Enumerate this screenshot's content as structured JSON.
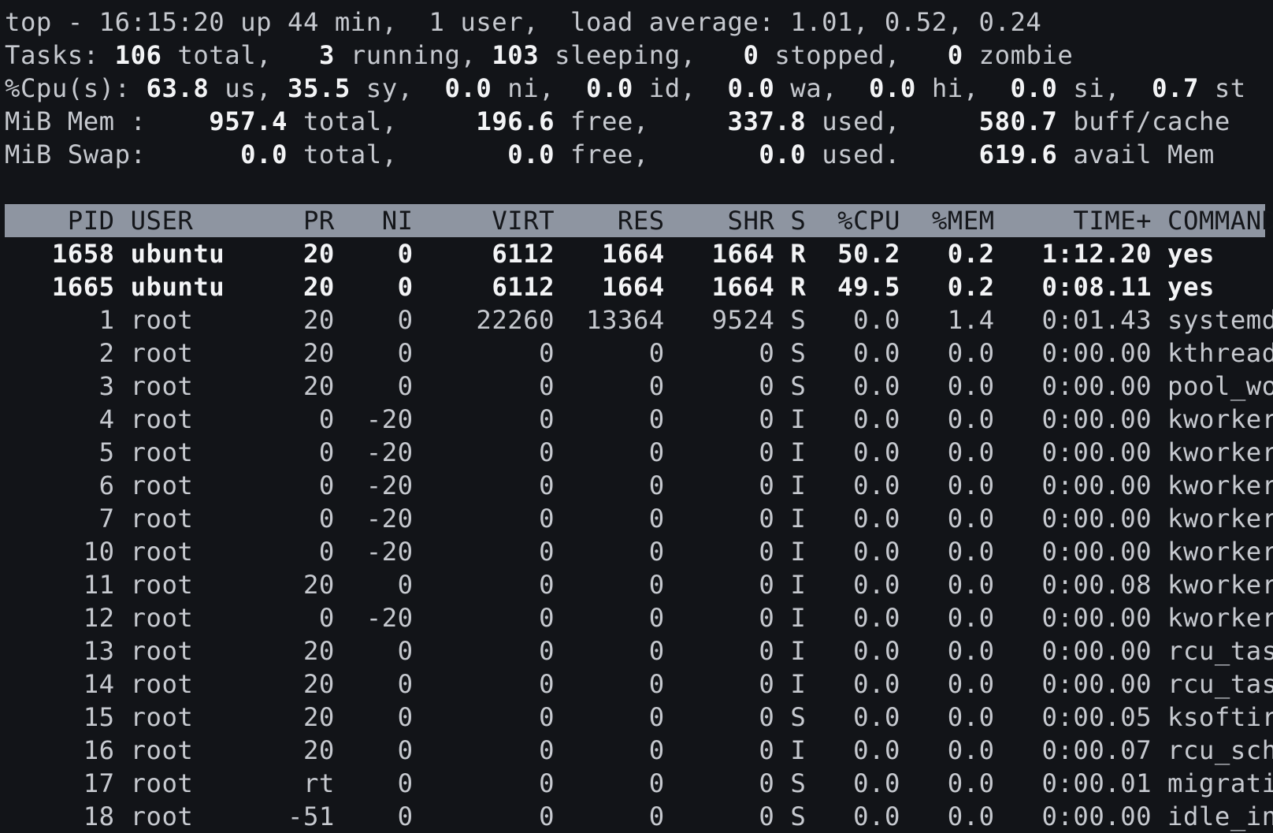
{
  "summary": {
    "top_line": "top - 16:15:20 up 44 min,  1 user,  load average: 1.01, 0.52, 0.24",
    "tasks": {
      "label": "Tasks:",
      "total": "106",
      "total_label": " total,",
      "running": "3",
      "running_label": " running,",
      "sleeping": "103",
      "sleeping_label": " sleeping,",
      "stopped": "0",
      "stopped_label": " stopped,",
      "zombie": "0",
      "zombie_label": " zombie"
    },
    "cpu": {
      "label": "%Cpu(s):",
      "us": "63.8",
      "us_label": " us,",
      "sy": "35.5",
      "sy_label": " sy,",
      "ni": "0.0",
      "ni_label": " ni,",
      "id": "0.0",
      "id_label": " id,",
      "wa": "0.0",
      "wa_label": " wa,",
      "hi": "0.0",
      "hi_label": " hi,",
      "si": "0.0",
      "si_label": " si,",
      "st": "0.7",
      "st_label": " st"
    },
    "mem": {
      "label": "MiB Mem :",
      "total": "957.4",
      "total_label": " total,",
      "free": "196.6",
      "free_label": " free,",
      "used": "337.8",
      "used_label": " used,",
      "buff": "580.7",
      "buff_label": " buff/cache"
    },
    "swap": {
      "label": "MiB Swap:",
      "total": "0.0",
      "total_label": " total,",
      "free": "0.0",
      "free_label": " free,",
      "used": "0.0",
      "used_label": " used.",
      "avail": "619.6",
      "avail_label": " avail Mem"
    }
  },
  "columns": [
    "PID",
    "USER",
    "PR",
    "NI",
    "VIRT",
    "RES",
    "SHR",
    "S",
    "%CPU",
    "%MEM",
    "TIME+",
    "COMMAND"
  ],
  "processes": [
    {
      "pid": "1658",
      "user": "ubuntu",
      "pr": "20",
      "ni": "0",
      "virt": "6112",
      "res": "1664",
      "shr": "1664",
      "s": "R",
      "cpu": "50.2",
      "mem": "0.2",
      "time": "1:12.20",
      "command": "yes",
      "bold": true
    },
    {
      "pid": "1665",
      "user": "ubuntu",
      "pr": "20",
      "ni": "0",
      "virt": "6112",
      "res": "1664",
      "shr": "1664",
      "s": "R",
      "cpu": "49.5",
      "mem": "0.2",
      "time": "0:08.11",
      "command": "yes",
      "bold": true
    },
    {
      "pid": "1",
      "user": "root",
      "pr": "20",
      "ni": "0",
      "virt": "22260",
      "res": "13364",
      "shr": "9524",
      "s": "S",
      "cpu": "0.0",
      "mem": "1.4",
      "time": "0:01.43",
      "command": "systemd",
      "bold": false
    },
    {
      "pid": "2",
      "user": "root",
      "pr": "20",
      "ni": "0",
      "virt": "0",
      "res": "0",
      "shr": "0",
      "s": "S",
      "cpu": "0.0",
      "mem": "0.0",
      "time": "0:00.00",
      "command": "kthreadd",
      "bold": false
    },
    {
      "pid": "3",
      "user": "root",
      "pr": "20",
      "ni": "0",
      "virt": "0",
      "res": "0",
      "shr": "0",
      "s": "S",
      "cpu": "0.0",
      "mem": "0.0",
      "time": "0:00.00",
      "command": "pool_wo+",
      "bold": false
    },
    {
      "pid": "4",
      "user": "root",
      "pr": "0",
      "ni": "-20",
      "virt": "0",
      "res": "0",
      "shr": "0",
      "s": "I",
      "cpu": "0.0",
      "mem": "0.0",
      "time": "0:00.00",
      "command": "kworker+",
      "bold": false
    },
    {
      "pid": "5",
      "user": "root",
      "pr": "0",
      "ni": "-20",
      "virt": "0",
      "res": "0",
      "shr": "0",
      "s": "I",
      "cpu": "0.0",
      "mem": "0.0",
      "time": "0:00.00",
      "command": "kworker+",
      "bold": false
    },
    {
      "pid": "6",
      "user": "root",
      "pr": "0",
      "ni": "-20",
      "virt": "0",
      "res": "0",
      "shr": "0",
      "s": "I",
      "cpu": "0.0",
      "mem": "0.0",
      "time": "0:00.00",
      "command": "kworker+",
      "bold": false
    },
    {
      "pid": "7",
      "user": "root",
      "pr": "0",
      "ni": "-20",
      "virt": "0",
      "res": "0",
      "shr": "0",
      "s": "I",
      "cpu": "0.0",
      "mem": "0.0",
      "time": "0:00.00",
      "command": "kworker+",
      "bold": false
    },
    {
      "pid": "10",
      "user": "root",
      "pr": "0",
      "ni": "-20",
      "virt": "0",
      "res": "0",
      "shr": "0",
      "s": "I",
      "cpu": "0.0",
      "mem": "0.0",
      "time": "0:00.00",
      "command": "kworker+",
      "bold": false
    },
    {
      "pid": "11",
      "user": "root",
      "pr": "20",
      "ni": "0",
      "virt": "0",
      "res": "0",
      "shr": "0",
      "s": "I",
      "cpu": "0.0",
      "mem": "0.0",
      "time": "0:00.08",
      "command": "kworker+",
      "bold": false
    },
    {
      "pid": "12",
      "user": "root",
      "pr": "0",
      "ni": "-20",
      "virt": "0",
      "res": "0",
      "shr": "0",
      "s": "I",
      "cpu": "0.0",
      "mem": "0.0",
      "time": "0:00.00",
      "command": "kworker+",
      "bold": false
    },
    {
      "pid": "13",
      "user": "root",
      "pr": "20",
      "ni": "0",
      "virt": "0",
      "res": "0",
      "shr": "0",
      "s": "I",
      "cpu": "0.0",
      "mem": "0.0",
      "time": "0:00.00",
      "command": "rcu_tas+",
      "bold": false
    },
    {
      "pid": "14",
      "user": "root",
      "pr": "20",
      "ni": "0",
      "virt": "0",
      "res": "0",
      "shr": "0",
      "s": "I",
      "cpu": "0.0",
      "mem": "0.0",
      "time": "0:00.00",
      "command": "rcu_tas+",
      "bold": false
    },
    {
      "pid": "15",
      "user": "root",
      "pr": "20",
      "ni": "0",
      "virt": "0",
      "res": "0",
      "shr": "0",
      "s": "S",
      "cpu": "0.0",
      "mem": "0.0",
      "time": "0:00.05",
      "command": "ksoftir+",
      "bold": false
    },
    {
      "pid": "16",
      "user": "root",
      "pr": "20",
      "ni": "0",
      "virt": "0",
      "res": "0",
      "shr": "0",
      "s": "I",
      "cpu": "0.0",
      "mem": "0.0",
      "time": "0:00.07",
      "command": "rcu_sch+",
      "bold": false
    },
    {
      "pid": "17",
      "user": "root",
      "pr": "rt",
      "ni": "0",
      "virt": "0",
      "res": "0",
      "shr": "0",
      "s": "S",
      "cpu": "0.0",
      "mem": "0.0",
      "time": "0:00.01",
      "command": "migrati+",
      "bold": false
    },
    {
      "pid": "18",
      "user": "root",
      "pr": "-51",
      "ni": "0",
      "virt": "0",
      "res": "0",
      "shr": "0",
      "s": "S",
      "cpu": "0.0",
      "mem": "0.0",
      "time": "0:00.00",
      "command": "idle_in+",
      "bold": false
    }
  ],
  "colors": {
    "background": "#121418",
    "text": "#c6c9cf",
    "bold_text": "#f3f4f6",
    "header_bar": "#8e95a1",
    "header_text": "#14161a"
  }
}
